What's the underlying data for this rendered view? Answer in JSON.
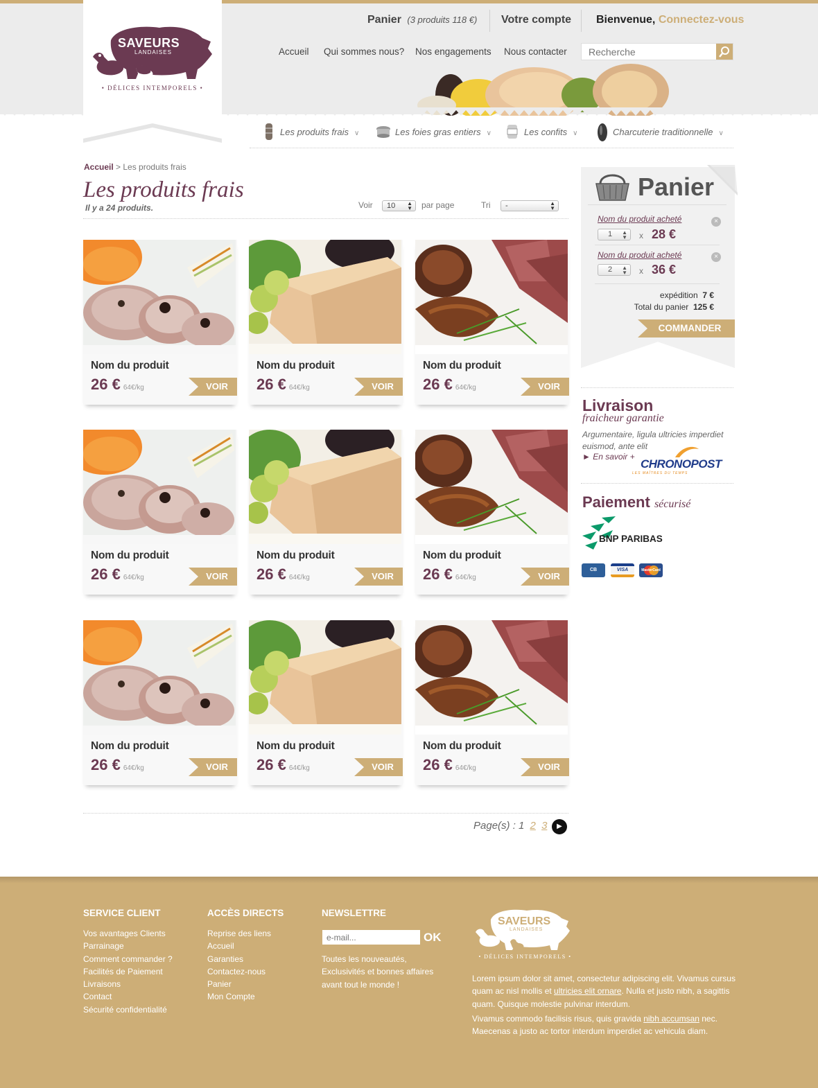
{
  "header": {
    "cart_label": "Panier",
    "cart_summary": "(3 produits 118 €)",
    "account": "Votre compte",
    "welcome": "Bienvenue,",
    "connect": "Connectez-vous",
    "logo_main": "SAVEURS",
    "logo_sub": "LANDAISES",
    "logo_tagline": "• Délices Intemporels •",
    "nav": [
      "Accueil",
      "Qui sommes nous?",
      "Nos engagements",
      "Nous contacter"
    ],
    "search_placeholder": "Recherche",
    "categories": [
      "Les produits frais",
      "Les foies gras entiers",
      "Les confits",
      "Charcuterie traditionnelle"
    ]
  },
  "breadcrumb": {
    "home": "Accueil",
    "current": "> Les produits frais"
  },
  "page": {
    "title": "Les produits frais",
    "count": "Il y a 24 produits.",
    "voir_label": "Voir",
    "per_page_value": "10",
    "per_page_label": "par page",
    "tri_label": "Tri",
    "tri_value": "-"
  },
  "products": [
    {
      "name": "Nom du produit",
      "price": "26 €",
      "unit": "64€/kg",
      "button": "VOIR",
      "image": "pork-roast"
    },
    {
      "name": "Nom du produit",
      "price": "26 €",
      "unit": "64€/kg",
      "button": "VOIR",
      "image": "foie-gras"
    },
    {
      "name": "Nom du produit",
      "price": "26 €",
      "unit": "64€/kg",
      "button": "VOIR",
      "image": "duck-breast"
    },
    {
      "name": "Nom du produit",
      "price": "26 €",
      "unit": "64€/kg",
      "button": "VOIR",
      "image": "pork-roast"
    },
    {
      "name": "Nom du produit",
      "price": "26 €",
      "unit": "64€/kg",
      "button": "VOIR",
      "image": "foie-gras"
    },
    {
      "name": "Nom du produit",
      "price": "26 €",
      "unit": "64€/kg",
      "button": "VOIR",
      "image": "duck-breast"
    },
    {
      "name": "Nom du produit",
      "price": "26 €",
      "unit": "64€/kg",
      "button": "VOIR",
      "image": "pork-roast"
    },
    {
      "name": "Nom du produit",
      "price": "26 €",
      "unit": "64€/kg",
      "button": "VOIR",
      "image": "foie-gras"
    },
    {
      "name": "Nom du produit",
      "price": "26 €",
      "unit": "64€/kg",
      "button": "VOIR",
      "image": "duck-breast"
    }
  ],
  "pagination": {
    "label": "Page(s) : 1",
    "pages": [
      "2",
      "3"
    ]
  },
  "cart": {
    "title": "Panier",
    "items": [
      {
        "name": "Nom du produit acheté",
        "qty": "1",
        "x": "x",
        "price": "28 €"
      },
      {
        "name": "Nom du produit acheté",
        "qty": "2",
        "x": "x",
        "price": "36 €"
      }
    ],
    "shipping_label": "expédition",
    "shipping_value": "7 €",
    "total_label": "Total du panier",
    "total_value": "125 €",
    "order_button": "COMMANDER"
  },
  "livraison": {
    "title": "Livraison",
    "subtitle": "fraicheur garantie",
    "desc": "Argumentaire, ligula ultricies imperdiet euismod, ante elit",
    "more": "► En savoir +",
    "carrier": "CHRONOPOST",
    "carrier_tagline": "LES MAÎTRES DU TEMPS"
  },
  "paiement": {
    "title": "Paiement",
    "subtitle": "sécurisé",
    "bank": "BNP PARIBAS",
    "cards": [
      "CB",
      "VISA",
      "MasterCard"
    ]
  },
  "footer": {
    "service_title": "SERVICE CLIENT",
    "service_links": [
      "Vos avantages Clients",
      "Parrainage",
      "Comment commander ?",
      "Facilités de Paiement",
      "Livraisons",
      "Contact",
      "Sécurité confidentialité"
    ],
    "acces_title": "ACCÈS DIRECTS",
    "acces_links": [
      "Reprise des liens",
      "Accueil",
      "Garanties",
      "Contactez-nous",
      "Panier",
      "Mon Compte"
    ],
    "newsletter_title": "NEWSLETTRE",
    "email_placeholder": "e-mail...",
    "ok": "OK",
    "newsletter_text": [
      "Toutes les nouveautés,",
      "Exclusivités et bonnes affaires",
      "avant tout le monde !"
    ],
    "logo_main": "SAVEURS",
    "logo_sub": "LANDAISES",
    "logo_tagline": "• Délices Intemporels •",
    "para1_a": "Lorem ipsum dolor sit amet, consectetur adipiscing elit. Vivamus cursus quam ac nisl mollis et ",
    "para1_link": "ultricies elit ornare",
    "para1_b": ". Nulla et justo nibh, a sagittis quam. Quisque molestie pulvinar interdum.",
    "para2_a": "Vivamus commodo facilisis risus, quis gravida ",
    "para2_link": "nibh accumsan",
    "para2_b": " nec. Maecenas a justo ac tortor interdum imperdiet ac vehicula diam."
  },
  "colors": {
    "accent": "#cdae77",
    "brand": "#6b3a52",
    "text": "#555555"
  }
}
